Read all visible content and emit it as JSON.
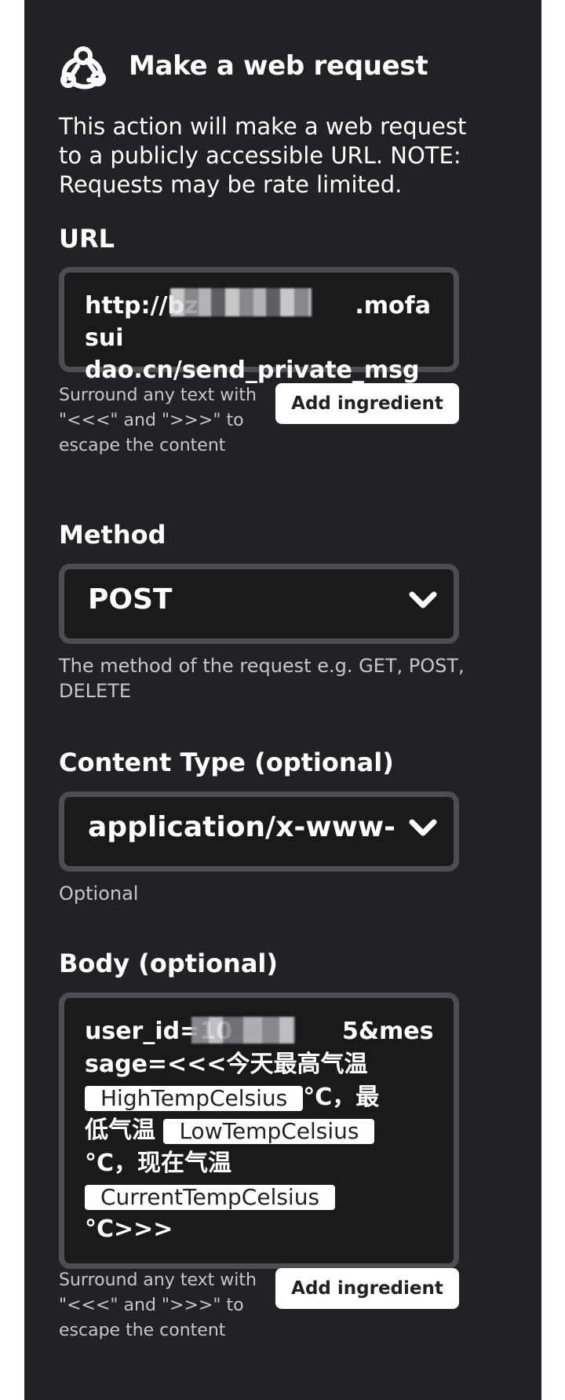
{
  "header": {
    "icon": "webhooks-icon",
    "title": "Make a web request"
  },
  "description": "This action will make a web request to a publicly accessible URL. NOTE: Requests may be rate limited.",
  "url_field": {
    "label": "URL",
    "value": "http://bzd▒▒▒▒▒.mofasuidao.cn/send_private_msg",
    "value_visible_part1": "http://bz",
    "value_visible_part2": ".mofasui",
    "value_line2": "dao.cn/send_private_msg",
    "hint": "Surround any text with \"<<<\" and \">>>\" to escape the content",
    "ingredient_button": "Add ingredient"
  },
  "method_field": {
    "label": "Method",
    "value": "POST",
    "help": "The method of the request e.g. GET, POST, DELETE"
  },
  "content_type_field": {
    "label": "Content Type (optional)",
    "value": "application/x-www-form-urlencoded",
    "help": "Optional"
  },
  "body_field": {
    "label": "Body (optional)",
    "line1_a": "user_id=10",
    "line1_b": "5&mes",
    "line2": "sage=<<<今天最高气温",
    "ingredient1": "HighTempCelsius",
    "after1": "°C，最",
    "before2": "低气温 ",
    "ingredient2": "LowTempCelsius",
    "line4": "°C，现在气温",
    "ingredient3": "CurrentTempCelsius",
    "line6": "°C>>>",
    "hint": "Surround any text with \"<<<\" and \">>>\" to escape the content",
    "ingredient_button": "Add ingredient"
  }
}
